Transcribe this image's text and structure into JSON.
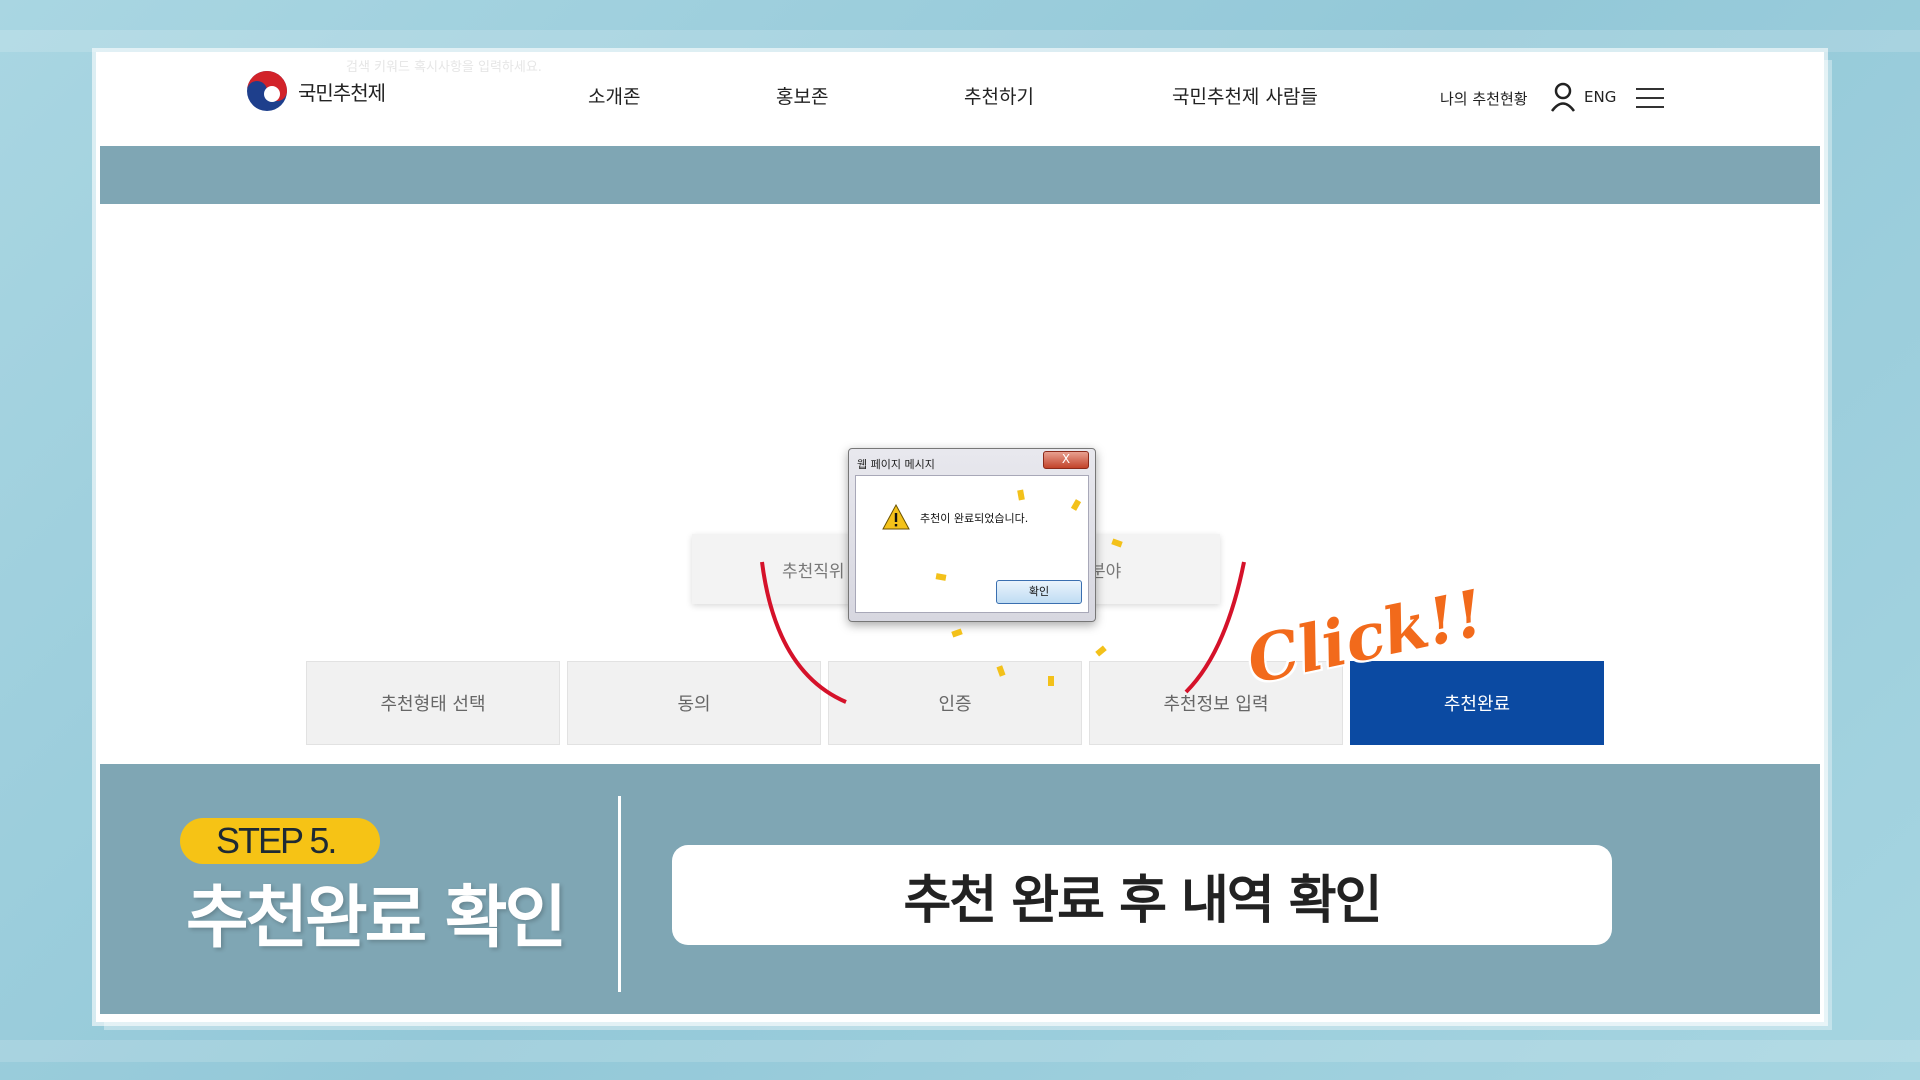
{
  "header": {
    "logo_text": "국민추천제",
    "hint_text": "검색 키워드 혹시사항을 입력하세요.",
    "nav": [
      "소개존",
      "홍보존",
      "추천하기",
      "국민추천제 사람들"
    ],
    "my_status": "나의 추천현황",
    "lang": "ENG"
  },
  "behind": {
    "left_label": "추천직위",
    "right_label": "분야"
  },
  "steps": [
    "추천형태 선택",
    "동의",
    "인증",
    "추천정보 입력",
    "추천완료"
  ],
  "active_step": 4,
  "dialog": {
    "title": "웹 페이지 메시지",
    "close": "X",
    "message": "추천이 완료되었습니다.",
    "ok": "확인"
  },
  "overlay": {
    "click_text": "Click!!"
  },
  "caption": {
    "step_label": "STEP 5.",
    "step_title": "추천완료 확인",
    "description": "추천 완료 후 내역 확인"
  },
  "colors": {
    "accent_blue": "#0b4aa2",
    "band": "#7fa6b4",
    "pill": "#f6c315",
    "click_orange": "#f26a1b"
  }
}
